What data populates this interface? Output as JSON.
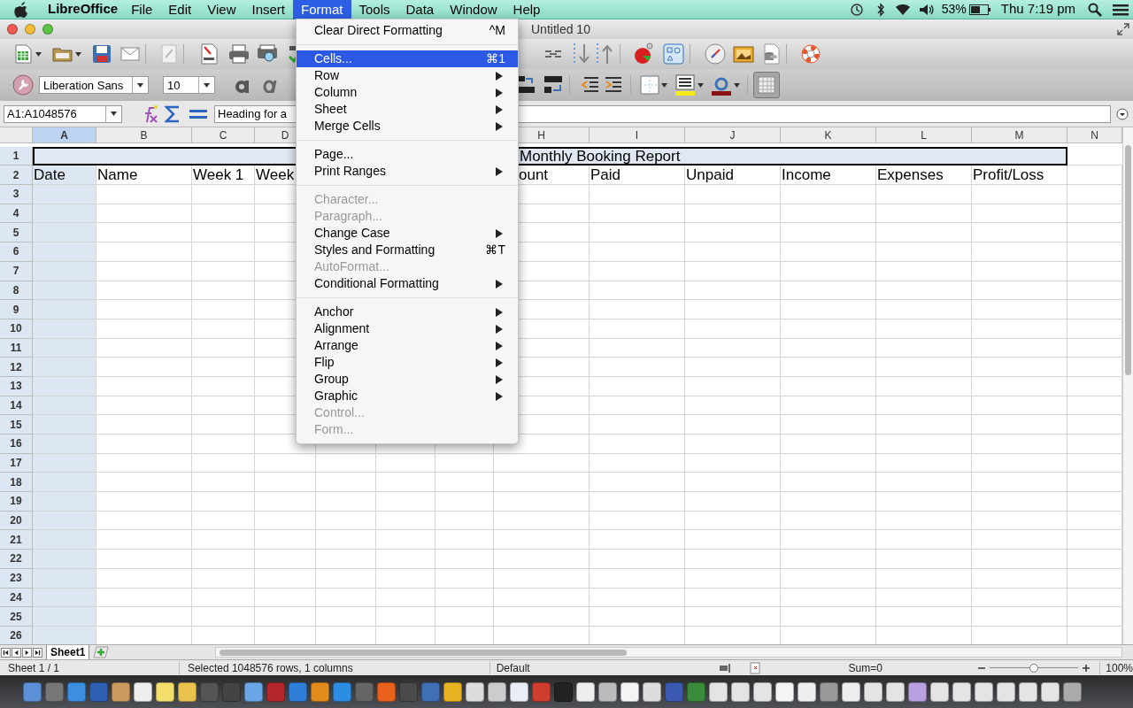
{
  "menu_bar": {
    "app_name": "LibreOffice",
    "items": [
      {
        "label": "File",
        "selected": false
      },
      {
        "label": "Edit",
        "selected": false
      },
      {
        "label": "View",
        "selected": false
      },
      {
        "label": "Insert",
        "selected": false
      },
      {
        "label": "Format",
        "selected": true
      },
      {
        "label": "Tools",
        "selected": false
      },
      {
        "label": "Data",
        "selected": false
      },
      {
        "label": "Window",
        "selected": false
      },
      {
        "label": "Help",
        "selected": false
      }
    ],
    "battery": "53%",
    "clock": "Thu 7:19 pm"
  },
  "window": {
    "title": "Untitled 10"
  },
  "toolbar": {
    "font_name": "Liberation Sans",
    "font_size": "10"
  },
  "formula_bar": {
    "name_box": "A1:A1048576",
    "content": "Heading for a"
  },
  "sheet": {
    "heading": "Monthly Booking Report",
    "columns": [
      {
        "label": "A",
        "selected": true,
        "row_2": "Date"
      },
      {
        "label": "B",
        "selected": false,
        "row_2": "Name"
      },
      {
        "label": "C",
        "selected": false,
        "row_2": "Week 1"
      },
      {
        "label": "D",
        "selected": false,
        "row_2": "Week"
      },
      {
        "label": "H",
        "selected": false,
        "row_2": "ount"
      },
      {
        "label": "I",
        "selected": false,
        "row_2": "Paid"
      },
      {
        "label": "J",
        "selected": false,
        "row_2": "Unpaid"
      },
      {
        "label": "K",
        "selected": false,
        "row_2": "Income"
      },
      {
        "label": "L",
        "selected": false,
        "row_2": "Expenses"
      },
      {
        "label": "M",
        "selected": false,
        "row_2": "Profit/Loss"
      },
      {
        "label": "N",
        "selected": false
      }
    ],
    "rows": [
      "1",
      "2",
      "3",
      "4",
      "5",
      "6",
      "7",
      "8",
      "9",
      "10",
      "11",
      "12",
      "13",
      "14",
      "15",
      "16",
      "17",
      "18",
      "19",
      "20",
      "21",
      "22",
      "23",
      "24",
      "25",
      "26"
    ],
    "tabs": [
      {
        "label": "Sheet1",
        "selected": true
      }
    ]
  },
  "status_bar": {
    "sheet": "Sheet 1 / 1",
    "selection": "Selected 1048576 rows, 1 columns",
    "page_style": "Default",
    "sum": "Sum=0",
    "zoom": "100%",
    "zoom_slider": {
      "level": 0.5
    }
  },
  "format_menu": {
    "groups": [
      [
        {
          "label": "Clear Direct Formatting",
          "shortcut": "^M",
          "submenu": false,
          "disabled": false,
          "selected": false
        }
      ],
      [
        {
          "label": "Cells...",
          "shortcut": "⌘1",
          "submenu": false,
          "disabled": false,
          "selected": true
        },
        {
          "label": "Row",
          "submenu": true,
          "disabled": false,
          "selected": false
        },
        {
          "label": "Column",
          "submenu": true,
          "disabled": false,
          "selected": false
        },
        {
          "label": "Sheet",
          "submenu": true,
          "disabled": false,
          "selected": false
        },
        {
          "label": "Merge Cells",
          "submenu": true,
          "disabled": false,
          "selected": false
        }
      ],
      [
        {
          "label": "Page...",
          "submenu": false,
          "disabled": false,
          "selected": false
        },
        {
          "label": "Print Ranges",
          "submenu": true,
          "disabled": false,
          "selected": false
        }
      ],
      [
        {
          "label": "Character...",
          "submenu": false,
          "disabled": true,
          "selected": false
        },
        {
          "label": "Paragraph...",
          "submenu": false,
          "disabled": true,
          "selected": false
        },
        {
          "label": "Change Case",
          "submenu": true,
          "disabled": false,
          "selected": false
        },
        {
          "label": "Styles and Formatting",
          "shortcut": "⌘T",
          "submenu": false,
          "disabled": false,
          "selected": false
        },
        {
          "label": "AutoFormat...",
          "submenu": false,
          "disabled": true,
          "selected": false
        },
        {
          "label": "Conditional Formatting",
          "submenu": true,
          "disabled": false,
          "selected": false
        }
      ],
      [
        {
          "label": "Anchor",
          "submenu": true,
          "disabled": false,
          "selected": false
        },
        {
          "label": "Alignment",
          "submenu": true,
          "disabled": false,
          "selected": false
        },
        {
          "label": "Arrange",
          "submenu": true,
          "disabled": false,
          "selected": false
        },
        {
          "label": "Flip",
          "submenu": true,
          "disabled": false,
          "selected": false
        },
        {
          "label": "Group",
          "submenu": true,
          "disabled": false,
          "selected": false
        },
        {
          "label": "Graphic",
          "submenu": true,
          "disabled": false,
          "selected": false
        },
        {
          "label": "Control...",
          "submenu": false,
          "disabled": true,
          "selected": false
        },
        {
          "label": "Form...",
          "submenu": false,
          "disabled": true,
          "selected": false
        }
      ]
    ]
  }
}
